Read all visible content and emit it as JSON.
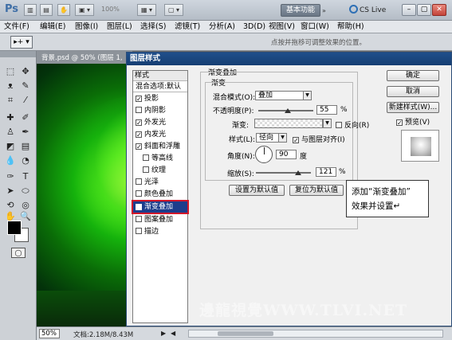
{
  "titlebar": {
    "app_logo": "Ps",
    "zoom": "100%",
    "workspace_btn": "基本功能",
    "cslive": "CS Live"
  },
  "menu": [
    "文件(F)",
    "编辑(E)",
    "图像(I)",
    "图层(L)",
    "选择(S)",
    "滤镜(T)",
    "分析(A)",
    "3D(D)",
    "视图(V)",
    "窗口(W)",
    "帮助(H)"
  ],
  "options": {
    "hint": "点按并拖移可调整效果的位置。"
  },
  "document": {
    "tab": "背景.psd @ 50% (图层 1,",
    "zoom": "50%",
    "info": "文档:2.18M/8.43M"
  },
  "dialog": {
    "title": "图层样式",
    "styles_header": "样式",
    "blend_options": "混合选项:默认",
    "styles": [
      {
        "label": "投影",
        "checked": true
      },
      {
        "label": "内阴影",
        "checked": false
      },
      {
        "label": "外发光",
        "checked": true
      },
      {
        "label": "内发光",
        "checked": true
      },
      {
        "label": "斜面和浮雕",
        "checked": true
      },
      {
        "label": "等高线",
        "checked": false
      },
      {
        "label": "纹理",
        "checked": false
      },
      {
        "label": "光泽",
        "checked": false
      },
      {
        "label": "颜色叠加",
        "checked": false
      },
      {
        "label": "渐变叠加",
        "checked": true
      },
      {
        "label": "图案叠加",
        "checked": false
      },
      {
        "label": "描边",
        "checked": false
      }
    ],
    "section_title": "渐变叠加",
    "group_title": "渐变",
    "blend_mode_label": "混合模式(O):",
    "blend_mode_value": "叠加",
    "opacity_label": "不透明度(P):",
    "opacity_value": "55",
    "opacity_unit": "%",
    "gradient_label": "渐变:",
    "reverse_label": "反向(R)",
    "style_label": "样式(L):",
    "style_value": "径向",
    "align_label": "与图层对齐(I)",
    "angle_label": "角度(N):",
    "angle_value": "90",
    "angle_unit": "度",
    "scale_label": "缩放(S):",
    "scale_value": "121",
    "scale_unit": "%",
    "make_default": "设置为默认值",
    "reset_default": "复位为默认值",
    "ok": "确定",
    "cancel": "取消",
    "new_style": "新建样式(W)...",
    "preview_label": "预览(V)"
  },
  "callout": {
    "line1": "添加“渐变叠加”",
    "line2": "效果并设置↵"
  },
  "watermark": "邊龍視覺WWW.TLVI.NET"
}
